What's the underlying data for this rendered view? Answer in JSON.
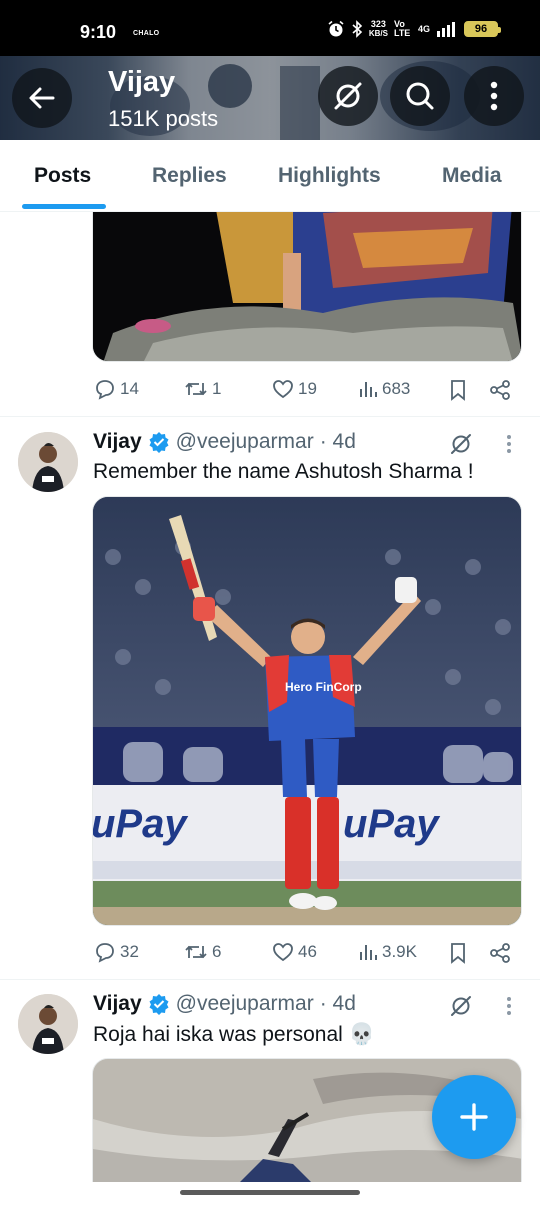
{
  "status_bar": {
    "time": "9:10",
    "carrier": "CHALO",
    "net_speed_value": "323",
    "net_speed_unit": "KB/S",
    "volte": "Vo LTE",
    "network": "4G",
    "battery": "96"
  },
  "header": {
    "title": "Vijay",
    "subtitle": "151K posts"
  },
  "tabs": [
    {
      "label": "Posts",
      "active": true
    },
    {
      "label": "Replies",
      "active": false
    },
    {
      "label": "Highlights",
      "active": false
    },
    {
      "label": "Media",
      "active": false
    }
  ],
  "tweets": [
    {
      "media_description": "partial",
      "actions": {
        "replies": "14",
        "reposts": "1",
        "likes": "19",
        "views": "683"
      }
    },
    {
      "name": "Vijay",
      "handle": "@veejuparmar",
      "time": "· 4d",
      "text": "Remember the name Ashutosh Sharma !",
      "banner_text": "uPay",
      "jersey_text": "Hero FinCorp",
      "actions": {
        "replies": "32",
        "reposts": "6",
        "likes": "46",
        "views": "3.9K"
      }
    },
    {
      "name": "Vijay",
      "handle": "@veejuparmar",
      "time": "· 4d",
      "text": "Roja hai iska was personal",
      "emoji": "💀"
    }
  ],
  "colors": {
    "accent": "#1d9bf0",
    "text_primary": "#0f1419",
    "text_secondary": "#536471",
    "verified": "#1d9bf0"
  }
}
